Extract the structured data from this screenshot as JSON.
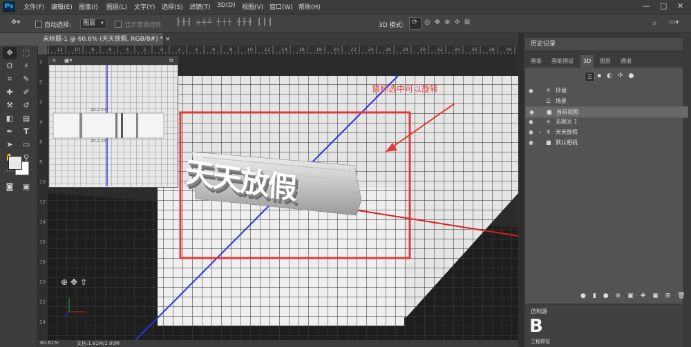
{
  "app": {
    "logo": "Ps"
  },
  "menu": [
    "文件(F)",
    "编辑(E)",
    "图像(I)",
    "图层(L)",
    "文字(Y)",
    "选择(S)",
    "滤镜(T)",
    "3D(D)",
    "视图(V)",
    "窗口(W)",
    "帮助(H)"
  ],
  "window_controls": {
    "minimize": "—",
    "restore": "□",
    "close": "✕"
  },
  "options": {
    "auto_select_label": "自动选择:",
    "auto_select_value": "图层",
    "show_transform_label": "显示变换控件",
    "mode_3d_label": "3D 模式:"
  },
  "document": {
    "tab_title": "未标题-1 @ 60.6% (天天放假, RGB/8#) *",
    "close": "×"
  },
  "rulers": {
    "top": [
      "12",
      "10",
      "8",
      "6",
      "4",
      "2",
      "0",
      "2",
      "4",
      "6",
      "8",
      "10",
      "12",
      "14",
      "16",
      "18",
      "20",
      "22",
      "24",
      "26",
      "28",
      "30",
      "32",
      "34",
      "36",
      "38",
      "40"
    ],
    "left": [
      "2",
      "0",
      "2",
      "4",
      "6",
      "8",
      "10",
      "12",
      "14",
      "16",
      "18",
      "20",
      "22",
      "24"
    ]
  },
  "canvas": {
    "annotation": "鼠标选中可以旋转",
    "text_3d": "天天放假",
    "preview_close": "×",
    "preview_label_top": "20.2 cm",
    "preview_label_bottom": "20.2 cm"
  },
  "status": {
    "zoom": "60.61%",
    "doc": "文档:1.82M/2.80M"
  },
  "history_panel": {
    "title": "历史记录"
  },
  "panel_tabs": [
    "画笔",
    "画笔预设",
    "3D",
    "图层",
    "通道"
  ],
  "active_tab": "3D",
  "scene_items": [
    {
      "name": "环境",
      "icon": "environment-icon",
      "eye": true,
      "indent": 0
    },
    {
      "name": "场景",
      "icon": "scene-icon",
      "eye": false,
      "indent": 0
    },
    {
      "name": "当前视图",
      "icon": "camera-icon",
      "eye": true,
      "indent": 1,
      "selected": true
    },
    {
      "name": "无限光 1",
      "icon": "light-icon",
      "eye": true,
      "indent": 1
    },
    {
      "name": "天天放假",
      "icon": "mesh-icon",
      "eye": true,
      "indent": 1,
      "expandable": true
    },
    {
      "name": "默认相机",
      "icon": "camera-icon",
      "eye": true,
      "indent": 1
    }
  ],
  "clone_panel": {
    "title": "仿制源",
    "sample_text": "B",
    "sample_subtext": "工程预览"
  },
  "colors": {
    "accent_red": "#e23a3a",
    "bg_dark": "#3c3c3c",
    "panel": "#535353"
  }
}
